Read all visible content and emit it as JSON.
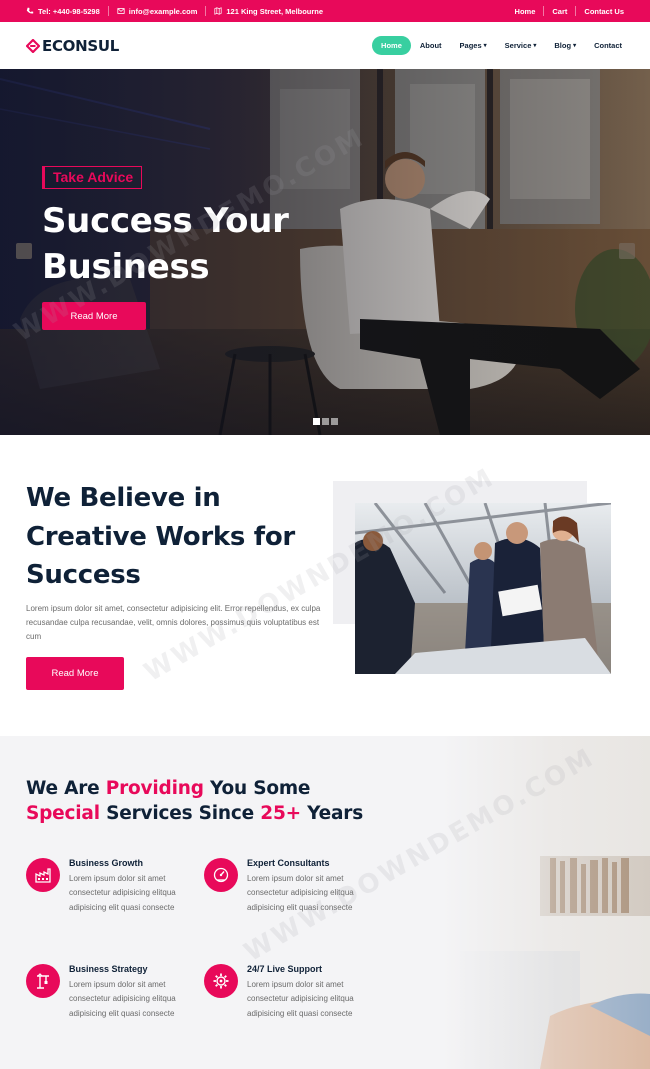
{
  "topbar": {
    "phone": "Tel: +440-98-5298",
    "email": "info@example.com",
    "address": "121 King Street, Melbourne",
    "links": [
      "Home",
      "Cart",
      "Contact Us"
    ]
  },
  "header": {
    "logo_text": "ECONSUL",
    "nav": [
      {
        "label": "Home",
        "active": true,
        "dropdown": false
      },
      {
        "label": "About",
        "active": false,
        "dropdown": false
      },
      {
        "label": "Pages",
        "active": false,
        "dropdown": true
      },
      {
        "label": "Service",
        "active": false,
        "dropdown": true
      },
      {
        "label": "Blog",
        "active": false,
        "dropdown": true
      },
      {
        "label": "Contact",
        "active": false,
        "dropdown": false
      }
    ]
  },
  "hero": {
    "tag": "Take Advice",
    "title": "Success Your Business",
    "button": "Read More",
    "slides": 3,
    "active_slide": 1
  },
  "about": {
    "title": "We Believe in Creative Works for Success",
    "text": "Lorem ipsum dolor sit amet, consectetur adipisicing elit. Error repellendus, ex culpa recusandae culpa recusandae, velit, omnis dolores, possimus quis voluptatibus est cum",
    "button": "Read More"
  },
  "services": {
    "heading": {
      "part1": "We Are ",
      "hl1": "Providing",
      "part2": " You Some",
      "hl2": "Special",
      "part3": " Services Since ",
      "hl3": "25+",
      "part4": " Years"
    },
    "items": [
      {
        "title": "Business Growth",
        "desc": "Lorem ipsum dolor sit amet consectetur adipisicing elitqua adipisicing elit quasi consecte",
        "icon": "factory-icon"
      },
      {
        "title": "Expert Consultants",
        "desc": "Lorem ipsum dolor sit amet consectetur adipisicing elitqua adipisicing elit quasi consecte",
        "icon": "gauge-icon"
      },
      {
        "title": "Business Strategy",
        "desc": "Lorem ipsum dolor sit amet consectetur adipisicing elitqua adipisicing elit quasi consecte",
        "icon": "crane-icon"
      },
      {
        "title": "24/7 Live Support",
        "desc": "Lorem ipsum dolor sit amet consectetur adipisicing elitqua adipisicing elit quasi consecte",
        "icon": "gear-support-icon"
      }
    ]
  },
  "watermark": "WWW.DOWNDEMO.COM",
  "colors": {
    "accent": "#e8095a",
    "active_nav": "#38cfa0",
    "dark": "#0f2137"
  }
}
